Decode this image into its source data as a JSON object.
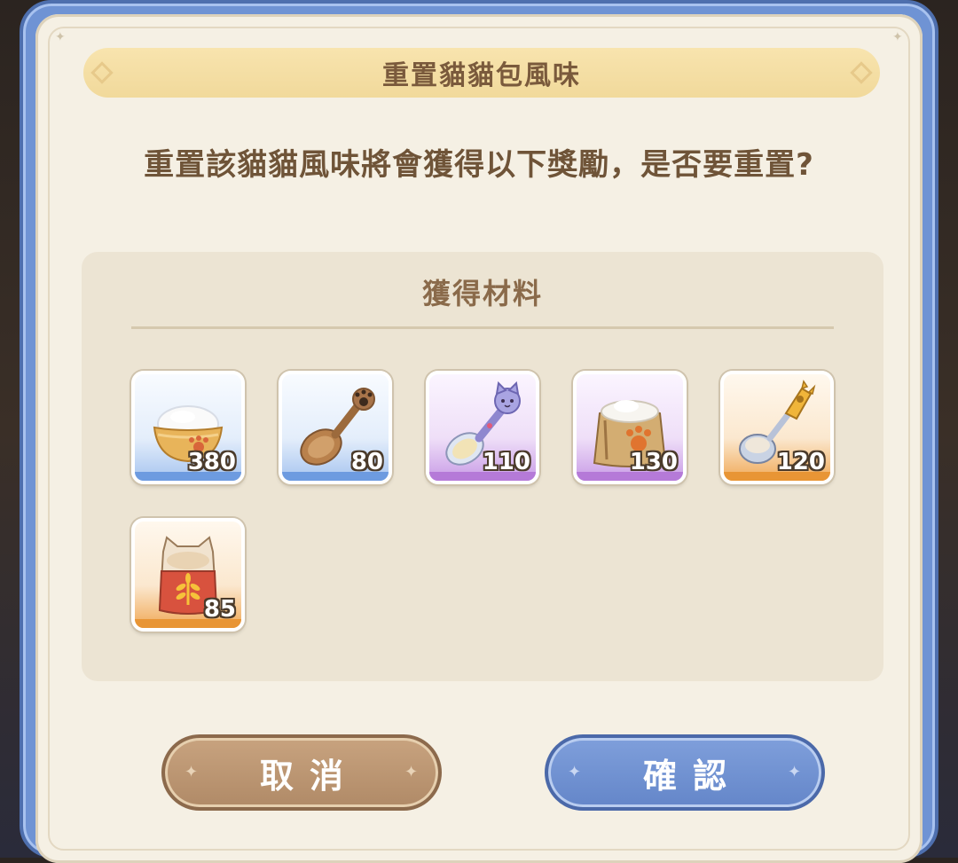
{
  "dialog": {
    "title": "重置貓貓包風味",
    "question": "重置該貓貓風味將會獲得以下獎勵，是否要重置?"
  },
  "materials": {
    "title": "獲得材料",
    "items": [
      {
        "name": "rice-bowl-icon",
        "quantity": "380",
        "rarity": "blue"
      },
      {
        "name": "wooden-paw-spoon-icon",
        "quantity": "80",
        "rarity": "blue"
      },
      {
        "name": "cat-spoon-icon",
        "quantity": "110",
        "rarity": "purple"
      },
      {
        "name": "flour-sack-icon",
        "quantity": "130",
        "rarity": "purple"
      },
      {
        "name": "scoop-spoon-icon",
        "quantity": "120",
        "rarity": "orange"
      },
      {
        "name": "wheat-bag-icon",
        "quantity": "85",
        "rarity": "orange"
      }
    ]
  },
  "buttons": {
    "cancel": "取消",
    "confirm": "確認"
  },
  "colors": {
    "frame": "#6f93d4",
    "panel": "#f5f0e4",
    "title_bar": "#f1d99b",
    "text": "#6f5438",
    "cancel": "#b08a67",
    "confirm": "#6486c9"
  }
}
